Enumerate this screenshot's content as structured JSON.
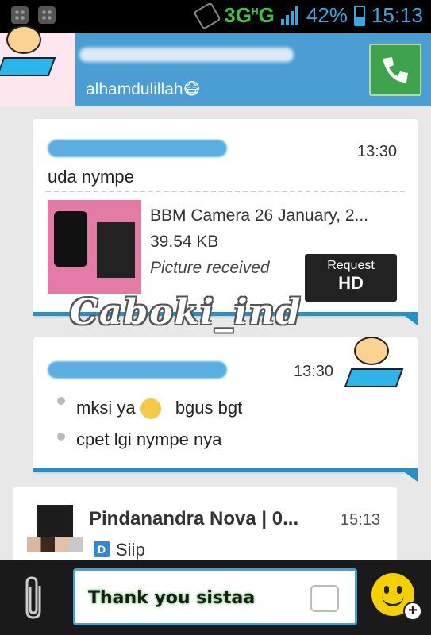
{
  "status_bar": {
    "network": "3G",
    "network_sub": "H",
    "network_g": "G",
    "battery": "42%",
    "time": "15:13"
  },
  "header": {
    "status": "alhamdulillah😷"
  },
  "messages": [
    {
      "time": "13:30",
      "text": "uda nympe",
      "attachment": {
        "title": "BBM Camera 26 January, 2...",
        "size": "39.54 KB",
        "status": "Picture received",
        "button_top": "Request",
        "button_bottom": "HD"
      }
    },
    {
      "time": "13:30",
      "lines": [
        "mksi ya",
        "bgus bgt",
        "cpet lgi nympe nya"
      ]
    }
  ],
  "watermark": "Caboki_ind",
  "chat_list": [
    {
      "name": "Pindanandra Nova | 0...",
      "time": "15:13",
      "badge": "D",
      "message": "Siip"
    }
  ],
  "composer": {
    "text": "Thank you sistaa"
  },
  "icons": [
    "bbm-icon",
    "vibrate-icon",
    "signal-icon",
    "battery-icon",
    "phone-icon",
    "paperclip-icon",
    "quick-reply-icon",
    "smiley-icon",
    "plus-icon"
  ]
}
